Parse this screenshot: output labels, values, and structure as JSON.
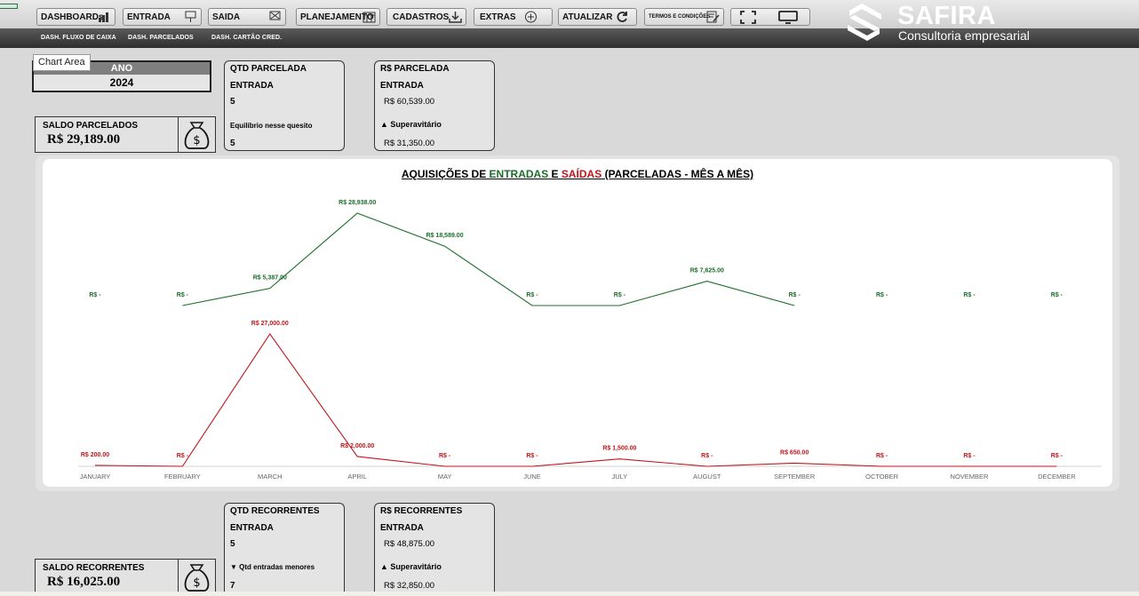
{
  "toolbar": {
    "buttons": [
      {
        "label": "DASHBOARDs",
        "icon": "bar-chart-icon"
      },
      {
        "label": "ENTRADA",
        "icon": "sign-in-icon"
      },
      {
        "label": "SAIDA",
        "icon": "sign-out-icon"
      },
      {
        "label": "PLANEJAMENTO",
        "icon": "calendar-icon"
      },
      {
        "label": "CADASTROS",
        "icon": "download-icon"
      },
      {
        "label": "EXTRAS",
        "icon": "plus-circle-icon"
      },
      {
        "label": "ATUALIZAR",
        "icon": "refresh-icon"
      },
      {
        "label": "TERMOS E CONDIÇÕES",
        "icon": "document-edit-icon"
      }
    ],
    "view_icons": [
      "fullscreen-icon",
      "monitor-icon"
    ]
  },
  "subnav": [
    "DASH. FLUXO DE CAIXA",
    "DASH. PARCELADOS",
    "DASH. CARTÃO CRED."
  ],
  "brand": {
    "title": "SAFIRA",
    "subtitle": "Consultoria empresarial"
  },
  "tooltip": "Chart Area",
  "year": {
    "label": "ANO",
    "value": "2024"
  },
  "saldo_parcelados": {
    "label": "SALDO PARCELADOS",
    "value": "R$ 29,189.00"
  },
  "saldo_recorrentes": {
    "label": "SALDO RECORRENTES",
    "value": "R$ 16,025.00"
  },
  "qtd_parcelada": {
    "title": "QTD PARCELADA",
    "sub": "ENTRADA",
    "value": "5",
    "status": "Equilíbrio nesse quesito",
    "status_value": "5"
  },
  "rs_parcelada": {
    "title": "R$ PARCELADA",
    "sub": "ENTRADA",
    "value": "R$ 60,539.00",
    "status": "▲ Superavitário",
    "status_value": "R$ 31,350.00"
  },
  "qtd_recorrentes": {
    "title": "QTD RECORRENTES",
    "sub": "ENTRADA",
    "value": "5",
    "status": "▼ Qtd entradas menores",
    "status_value": "7"
  },
  "rs_recorrentes": {
    "title": "R$ RECORRENTES",
    "sub": "ENTRADA",
    "value": "R$ 48,875.00",
    "status": "▲ Superavitário",
    "status_value": "R$ 32,850.00"
  },
  "chart": {
    "title_parts": [
      "AQUISIÇÕES DE ",
      "ENTRADAS",
      " E ",
      "SAÍDAS",
      " (PARCELADAS - MÊS A MÊS)"
    ]
  },
  "colors": {
    "entradas": "#1a6e2a",
    "saidas": "#c0161a"
  },
  "chart_data": {
    "type": "line",
    "title": "AQUISIÇÕES DE ENTRADAS E SAÍDAS (PARCELADAS - MÊS A MÊS)",
    "categories": [
      "JANUARY",
      "FEBRUARY",
      "MARCH",
      "APRIL",
      "MAY",
      "JUNE",
      "JULY",
      "AUGUST",
      "SEPTEMBER",
      "OCTOBER",
      "NOVEMBER",
      "DECEMBER"
    ],
    "series": [
      {
        "values": [
          null,
          0,
          5387,
          28938,
          18589,
          0,
          0,
          7625,
          0,
          null,
          null,
          null
        ],
        "labels": [
          "R$ -",
          "R$ -",
          "R$ 5,387.00",
          "R$ 28,938.00",
          "R$ 18,589.00",
          "R$ -",
          "R$ -",
          "R$ 7,625.00",
          "R$ -",
          "R$ -",
          "R$ -",
          "R$ -"
        ]
      },
      {
        "values": [
          200,
          0,
          27000,
          2000,
          0,
          0,
          1500,
          0,
          650,
          0,
          0,
          0
        ],
        "labels": [
          "R$ 200.00",
          "R$ -",
          "R$ 27,000.00",
          "R$ 2,000.00",
          "R$ -",
          "R$ -",
          "R$ 1,500.00",
          "R$ -",
          "R$ 650.00",
          "R$ -",
          "R$ -",
          "R$ -"
        ]
      }
    ],
    "grid": false,
    "legend": "none"
  }
}
